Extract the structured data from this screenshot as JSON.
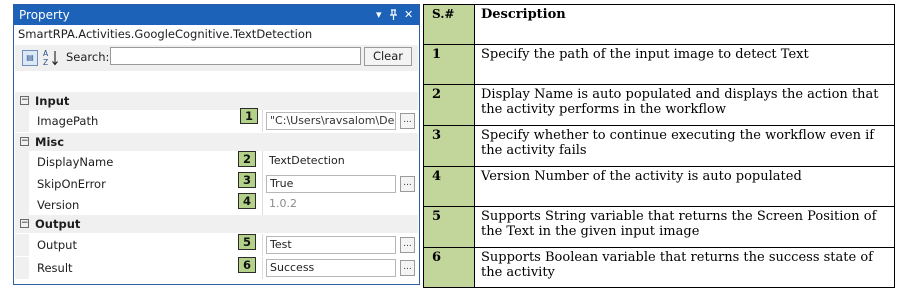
{
  "panel": {
    "title": "Property",
    "controls": {
      "menu": "▾",
      "pin": "ꟸ",
      "close": "✕"
    },
    "activity_name": "SmartRPA.Activities.GoogleCognitive.TextDetection",
    "toolbar": {
      "sort_icon": "categorized-sort-icon",
      "az_icon": "alphabetical-sort-icon",
      "search_label": "Search:",
      "search_value": "",
      "clear_label": "Clear"
    },
    "categories": {
      "input": {
        "label": "Input",
        "toggle": "−"
      },
      "misc": {
        "label": "Misc",
        "toggle": "−"
      },
      "output": {
        "label": "Output",
        "toggle": "−"
      }
    },
    "properties": {
      "image_path": {
        "name": "ImagePath",
        "value": "\"C:\\Users\\ravsalom\\Deskt",
        "badge": "1"
      },
      "display_name": {
        "name": "DisplayName",
        "value": "TextDetection",
        "badge": "2"
      },
      "skip_on_error": {
        "name": "SkipOnError",
        "value": "True",
        "badge": "3"
      },
      "version": {
        "name": "Version",
        "value": "1.0.2",
        "badge": "4"
      },
      "output": {
        "name": "Output",
        "value": "Test",
        "badge": "5"
      },
      "result": {
        "name": "Result",
        "value": "Success",
        "badge": "6"
      }
    },
    "ellipsis": "..."
  },
  "table": {
    "headers": {
      "number": "S.#",
      "description": "Description"
    },
    "rows": [
      {
        "number": "1",
        "description": "Specify the path of the input image to detect Text"
      },
      {
        "number": "2",
        "description": "Display Name is auto populated and displays the action that the activity performs in the workflow"
      },
      {
        "number": "3",
        "description": "Specify whether to continue executing the workflow even if the activity fails"
      },
      {
        "number": "4",
        "description": "Version Number of the activity is auto populated"
      },
      {
        "number": "5",
        "description": "Supports String variable that returns  the Screen Position of the Text in the given input image"
      },
      {
        "number": "6",
        "description": "Supports Boolean variable that returns the success state of the activity"
      }
    ]
  },
  "colors": {
    "titlebar": "#1c62b9",
    "badge": "#b4d18a",
    "table_number_column": "#c2d69b"
  }
}
